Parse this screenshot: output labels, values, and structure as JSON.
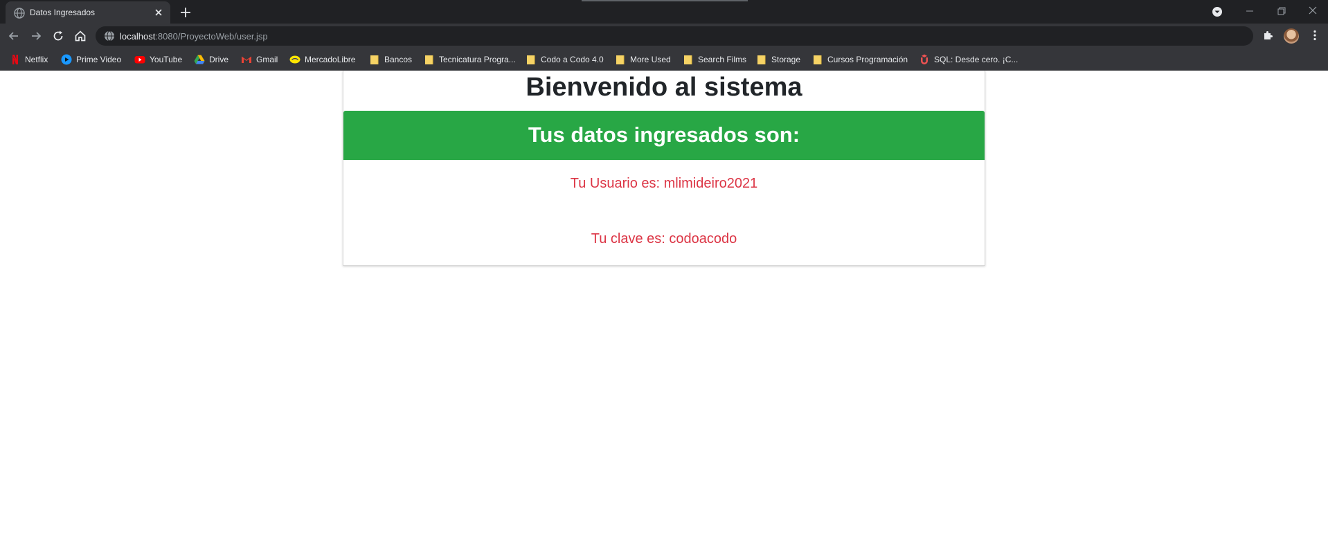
{
  "browser": {
    "tab": {
      "title": "Datos Ingresados"
    },
    "address": {
      "host": "localhost",
      "path": ":8080/ProyectoWeb/user.jsp"
    },
    "bookmarks": [
      {
        "label": "Netflix",
        "icon": "netflix-icon",
        "color": "#e50914"
      },
      {
        "label": "Prime Video",
        "icon": "prime-video-icon",
        "color": "#1a98ff"
      },
      {
        "label": "YouTube",
        "icon": "youtube-icon",
        "color": "#ff0000"
      },
      {
        "label": "Drive",
        "icon": "drive-icon",
        "color": "#34a853"
      },
      {
        "label": "Gmail",
        "icon": "gmail-icon",
        "color": "#ea4335"
      },
      {
        "label": "MercadoLibre",
        "icon": "mercadolibre-icon",
        "color": "#ffe600"
      },
      {
        "label": "Bancos",
        "icon": "folder-icon",
        "color": "#f6d365"
      },
      {
        "label": "Tecnicatura Progra...",
        "icon": "folder-icon",
        "color": "#f6d365"
      },
      {
        "label": "Codo a Codo 4.0",
        "icon": "folder-icon",
        "color": "#f6d365"
      },
      {
        "label": "More Used",
        "icon": "folder-icon",
        "color": "#f6d365"
      },
      {
        "label": "Search Films",
        "icon": "folder-icon",
        "color": "#f6d365"
      },
      {
        "label": "Storage",
        "icon": "folder-icon",
        "color": "#f6d365"
      },
      {
        "label": "Cursos Programación",
        "icon": "folder-icon",
        "color": "#f6d365"
      },
      {
        "label": "SQL: Desde cero. ¡C...",
        "icon": "udemy-icon",
        "color": "#ec5252"
      }
    ]
  },
  "page": {
    "title": "Bienvenido al sistema",
    "card_header": "Tus datos ingresados son:",
    "user_line": "Tu Usuario es: mlimideiro2021",
    "password_line": "Tu clave es: codoacodo"
  },
  "colors": {
    "header_green": "#28a745",
    "info_red": "#dc3545",
    "chrome_dark": "#35363a"
  }
}
